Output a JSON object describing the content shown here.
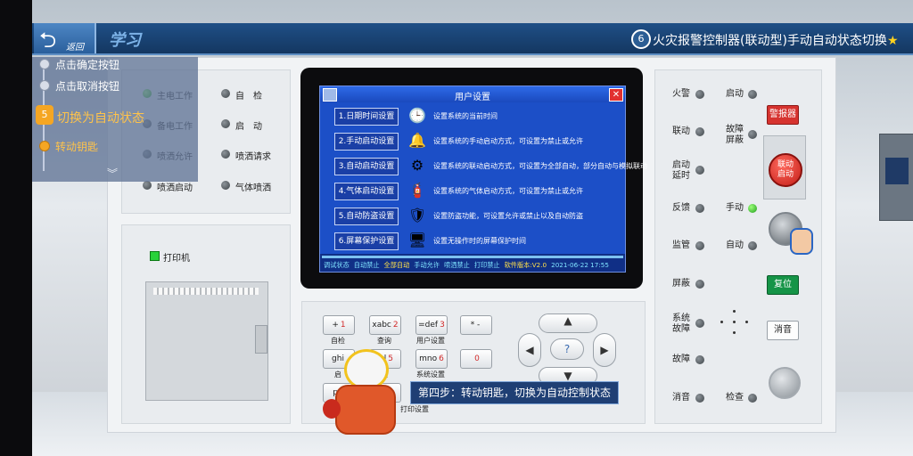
{
  "header": {
    "back_label": "返回",
    "section_title": "学习",
    "step_number": "6",
    "course_title": "火灾报警控制器(联动型)手动自动状态切换"
  },
  "nav": {
    "items": [
      {
        "label": "点击确定按钮"
      },
      {
        "label": "点击取消按钮"
      },
      {
        "label": "切换为自动状态",
        "badge": "5"
      },
      {
        "label": "转动钥匙"
      }
    ]
  },
  "left_panel": {
    "indicators": [
      {
        "label": "主电工作",
        "lit": true
      },
      {
        "label": "自　检",
        "lit": false
      },
      {
        "label": "备电工作",
        "lit": false
      },
      {
        "label": "启　动",
        "lit": false
      },
      {
        "label": "喷洒允许",
        "lit": false
      },
      {
        "label": "喷洒请求",
        "lit": false
      },
      {
        "label": "喷洒启动",
        "lit": false
      },
      {
        "label": "气体喷洒",
        "lit": false
      }
    ],
    "printer_label": "打印机"
  },
  "screen": {
    "title": "用户设置",
    "menu": [
      {
        "button": "1.日期时间设置",
        "icon": "clock-icon",
        "desc": "设置系统的当前时间"
      },
      {
        "button": "2.手动启动设置",
        "icon": "fire-alarm-icon",
        "desc": "设置系统的手动启动方式，可设置为禁止或允许"
      },
      {
        "button": "3.自动启动设置",
        "icon": "gears-icon",
        "desc": "设置系统的联动启动方式，可设置为全部自动，部分自动与模拟联动"
      },
      {
        "button": "4.气体启动设置",
        "icon": "gas-cylinder-icon",
        "desc": "设置系统的气体启动方式，可设置为禁止或允许"
      },
      {
        "button": "5.自动防盗设置",
        "icon": "shield-icon",
        "desc": "设置防盗功能，可设置允许或禁止以及自动防盗"
      },
      {
        "button": "6.屏幕保护设置",
        "icon": "monitor-icon",
        "desc": "设置无操作时的屏幕保护时间"
      }
    ],
    "status": [
      {
        "text": "调试状态",
        "color": "#7fe3ff"
      },
      {
        "text": "自动禁止",
        "color": "#7fe3ff"
      },
      {
        "text": "全部自动",
        "color": "#ffe14a"
      },
      {
        "text": "手动允许",
        "color": "#7fe3ff"
      },
      {
        "text": "喷洒禁止",
        "color": "#7fe3ff"
      },
      {
        "text": "打印禁止",
        "color": "#7fe3ff"
      },
      {
        "text": "软件版本:V2.0",
        "color": "#ffe14a"
      },
      {
        "text": "2021-06-22 17:55",
        "color": "#7fe3ff"
      }
    ]
  },
  "keypad": {
    "keys": [
      {
        "main": "+",
        "num": "1",
        "caption": "自检"
      },
      {
        "main": "xabc",
        "num": "2",
        "caption": "查询"
      },
      {
        "main": "=def",
        "num": "3",
        "caption": "用户设置"
      },
      {
        "main": "* -",
        "num": "",
        "caption": ""
      },
      {
        "main": "ghi",
        "num": "",
        "caption": "启"
      },
      {
        "main": "jkl",
        "num": "5",
        "caption": "板"
      },
      {
        "main": "mno",
        "num": "6",
        "caption": "系统设置"
      },
      {
        "main": "",
        "num": "0",
        "caption": ""
      },
      {
        "main": "pq",
        "num": "",
        "caption": ""
      },
      {
        "main": "uv",
        "num": "8",
        "caption": ""
      }
    ],
    "extra_caption": "打印设置",
    "dpad_center": "?"
  },
  "right_panel": {
    "left_col": [
      "火警",
      "联动",
      "启动\n延时",
      "反馈",
      "监管",
      "屏蔽",
      "系统\n故障",
      "故障",
      "消音"
    ],
    "right_col": [
      {
        "label": "启动",
        "lit": false
      },
      {
        "label": "故障\n屏蔽",
        "lit": false
      },
      {
        "label": "手动",
        "lit": true
      },
      {
        "label": "自动",
        "lit": false
      },
      {
        "label": "检查",
        "lit": false
      }
    ],
    "buttons": {
      "alarm": "警报器",
      "link_start": "联动\n启动",
      "reset": "复位",
      "mute": "消音"
    }
  },
  "tooltip": {
    "text": "第四步：转动钥匙，切换为自动控制状态"
  }
}
